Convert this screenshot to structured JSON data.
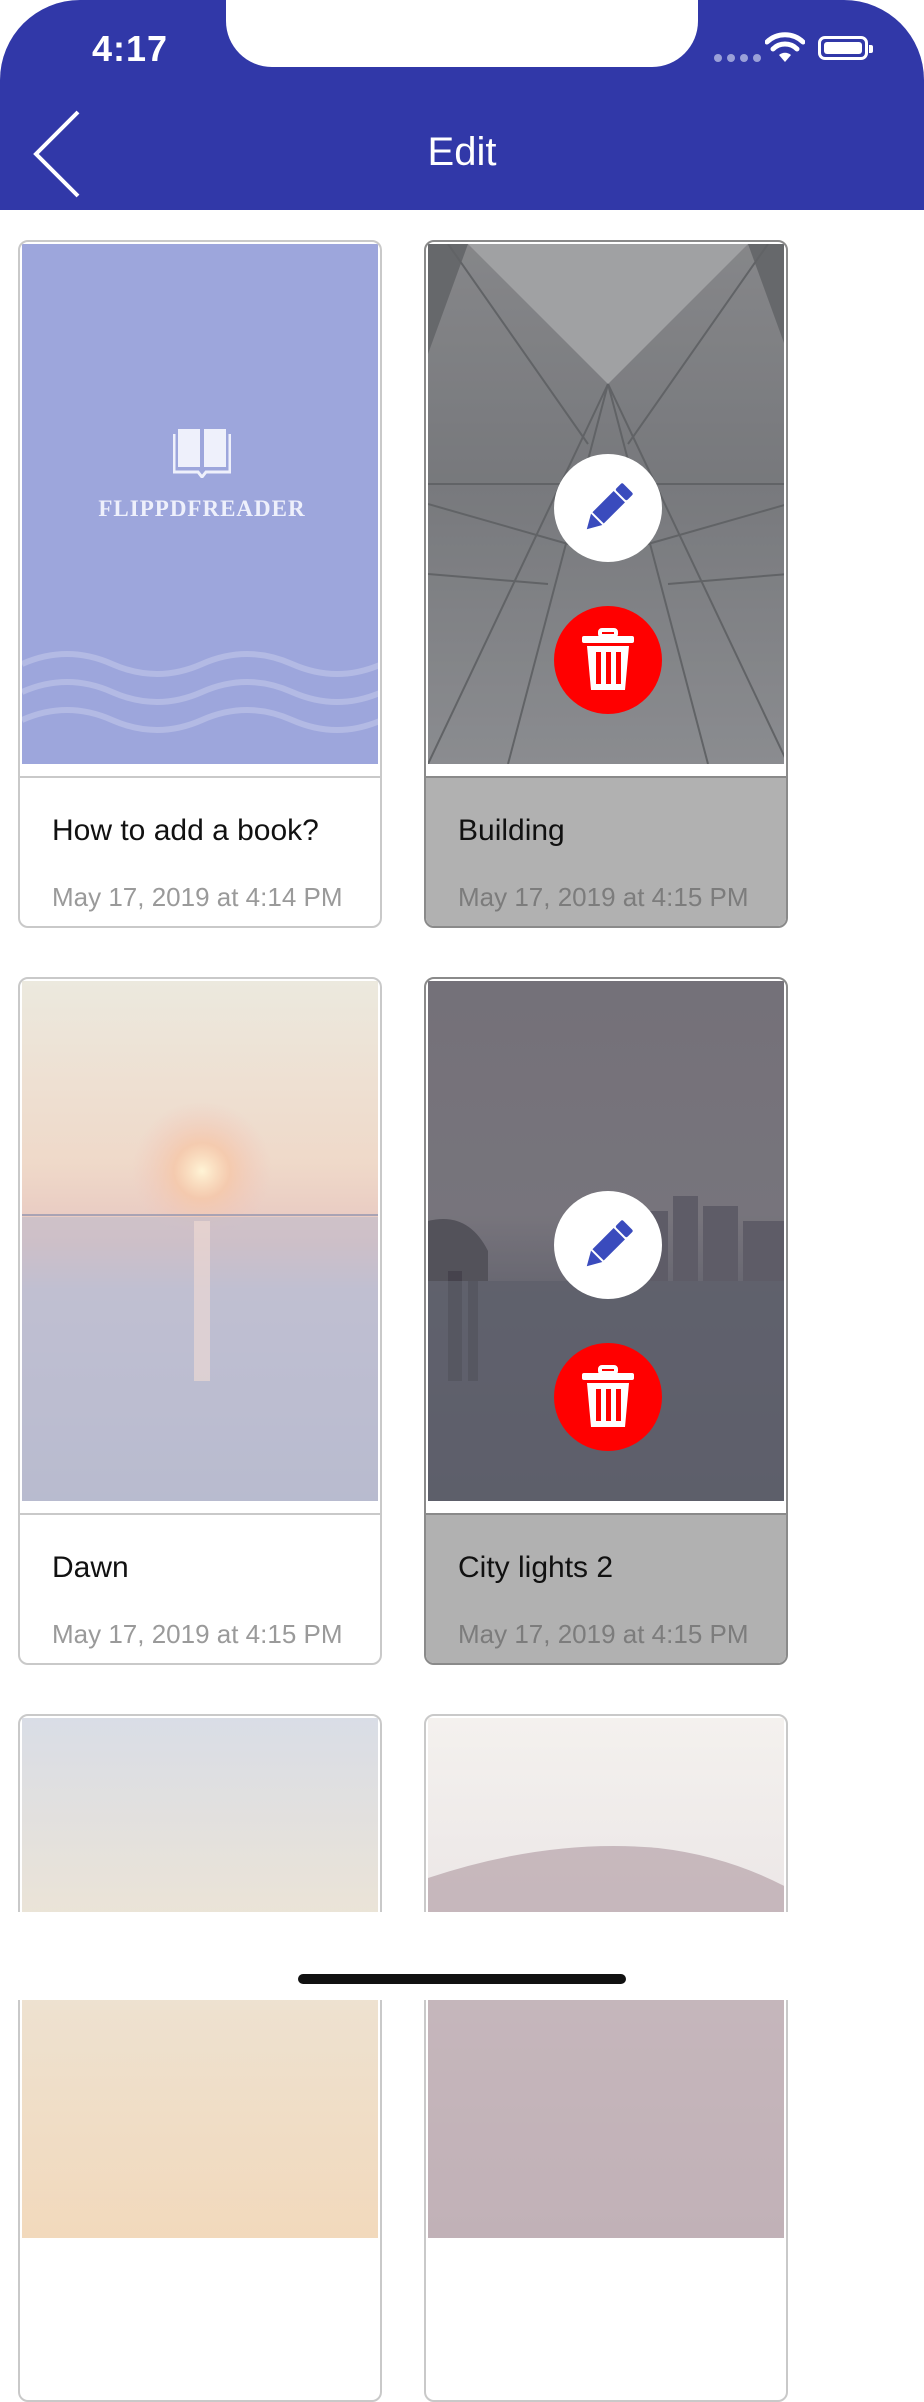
{
  "status_bar": {
    "time": "4:17"
  },
  "nav": {
    "title": "Edit"
  },
  "books": [
    {
      "title": "How to add a book?",
      "date": "May 17, 2019 at 4:14 PM",
      "cover_text": "FLIPPDFREADER",
      "selected": false
    },
    {
      "title": "Building",
      "date": "May 17, 2019 at 4:15 PM",
      "selected": true
    },
    {
      "title": "Dawn",
      "date": "May 17, 2019 at 4:15 PM",
      "selected": false
    },
    {
      "title": "City lights 2",
      "date": "May 17, 2019 at 4:15 PM",
      "selected": true
    }
  ],
  "icons": {
    "back": "chevron-left-icon",
    "edit": "pencil-icon",
    "delete": "trash-icon",
    "book": "open-book-icon"
  },
  "colors": {
    "header": "#3138a8",
    "edit_icon": "#3a4bbd",
    "delete_button": "#ff0000",
    "selected_info": "#b1b1b1"
  }
}
